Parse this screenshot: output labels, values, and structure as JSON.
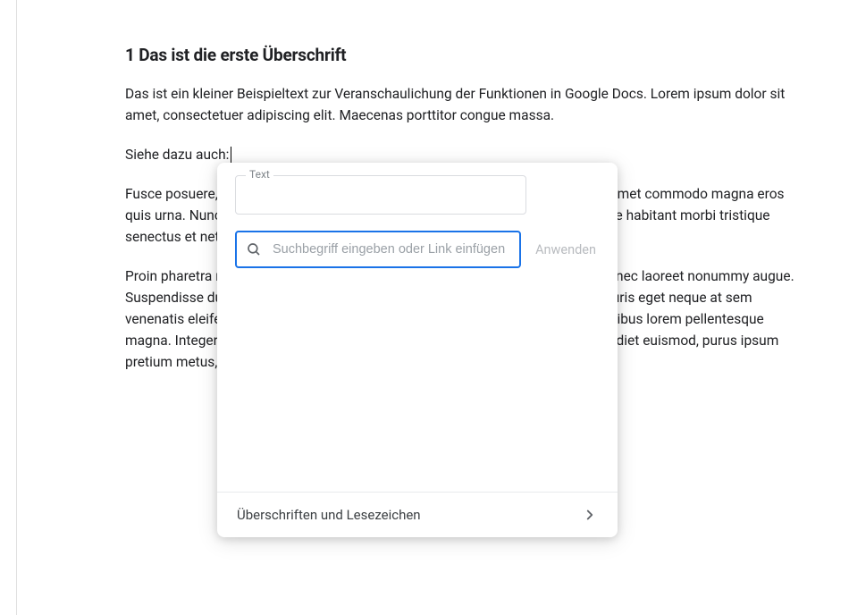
{
  "document": {
    "heading": "1 Das ist die erste Überschrift",
    "paragraph1": "Das ist ein kleiner Beispieltext zur Veranschaulichung der Funktionen in Google Docs. Lorem ipsum dolor sit amet, consectetuer adipiscing elit. Maecenas porttitor congue massa.",
    "paragraph2_prefix": "Siehe dazu auch:",
    "paragraph3": "Fusce posuere, magna sed pulvinar ultricies, purus lectus malesuada libero, sit amet commodo magna eros quis urna. Nunc viverra imperdiet enim. Fusce est. Vivamus a tellus. Pellentesque habitant morbi tristique senectus et netus et malesuada fames ac turpis egestas.",
    "paragraph4": "Proin pharetra nonummy pede. Mauris et orci. Aenean nec lorem. In porttitor. Donec laoreet nonummy augue. Suspendisse dui purus, scelerisque at, vulputate vitae, pretium mattis, nunc. Mauris eget neque at sem venenatis eleifend. Ut nonummy. Fusce aliquet pede non pede. Suspendisse dapibus lorem pellentesque magna. Integer nulla. Donec blandit feugiat ligula. Donec hendrerit, felis et imperdiet euismod, purus ipsum pretium metus, in lacinia nulla nisl eget sapien."
  },
  "linkDialog": {
    "textLabel": "Text",
    "textValue": "",
    "searchPlaceholder": "Suchbegriff eingeben oder Link einfügen",
    "applyLabel": "Anwenden",
    "footerLabel": "Überschriften und Lesezeichen"
  }
}
